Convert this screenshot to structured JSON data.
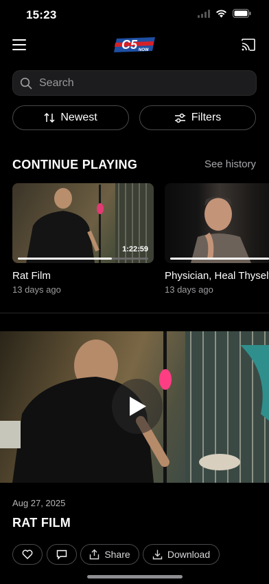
{
  "status_bar": {
    "time": "15:23"
  },
  "header": {
    "logo_text": "C5",
    "logo_subtext": "NOW"
  },
  "search": {
    "placeholder": "Search",
    "value": ""
  },
  "controls": {
    "sort_label": "Newest",
    "filter_label": "Filters"
  },
  "continue_playing": {
    "title": "CONTINUE PLAYING",
    "see_history": "See history",
    "items": [
      {
        "title": "Rat Film",
        "subtitle": "13 days ago",
        "duration": "1:22:59",
        "progress": 0.72
      },
      {
        "title": "Physician, Heal Thyself",
        "subtitle": "13 days ago",
        "duration": "",
        "progress": 0.95
      }
    ]
  },
  "featured": {
    "date": "Aug 27, 2025",
    "title": "RAT FILM",
    "actions": {
      "share": "Share",
      "download": "Download"
    }
  },
  "colors": {
    "background": "#000000",
    "surface": "#1c1c1e",
    "muted_text": "#9d9da1",
    "logo_red": "#d62027",
    "logo_blue": "#1e4fa3"
  }
}
